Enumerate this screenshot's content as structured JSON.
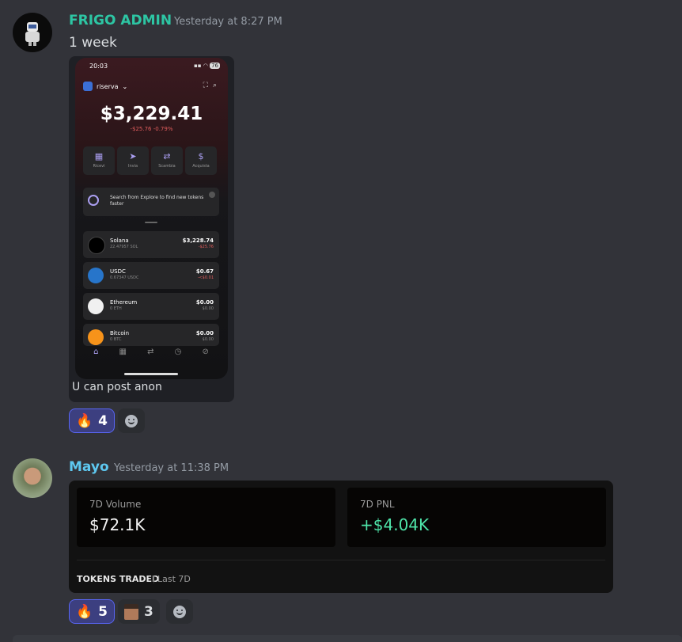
{
  "messages": [
    {
      "author": "FRIGO ADMIN",
      "author_color": "#2dc6a4",
      "timestamp": "Yesterday at 8:27 PM",
      "text": "1 week",
      "attachment": {
        "caption": "U can post anon",
        "phone": {
          "time": "20:03",
          "battery": "76",
          "account": "riserva",
          "balance": "$3,229.41",
          "change": "-$25.76 -0.79%",
          "actions": [
            "Ricevi",
            "Invia",
            "Scambia",
            "Acquista"
          ],
          "explore_text": "Search from Explore to find new tokens faster",
          "tokens": [
            {
              "name": "Solana",
              "sub": "22.47957 SOL",
              "value": "$3,228.74",
              "change": "-$25.76"
            },
            {
              "name": "USDC",
              "sub": "0.67347 USDC",
              "value": "$0.67",
              "change": "-<$0.01"
            },
            {
              "name": "Ethereum",
              "sub": "0 ETH",
              "value": "$0.00",
              "change": "$0.00"
            },
            {
              "name": "Bitcoin",
              "sub": "0 BTC",
              "value": "$0.00",
              "change": "$0.00"
            }
          ]
        }
      },
      "reactions": [
        {
          "emoji": "🔥",
          "count": "4"
        }
      ]
    },
    {
      "author": "Mayo",
      "author_color": "#5ec8f0",
      "timestamp": "Yesterday at 11:38 PM",
      "embed": {
        "stats": [
          {
            "label": "7D Volume",
            "value": "$72.1K"
          },
          {
            "label": "7D PNL",
            "value": "+$4.04K"
          }
        ],
        "section_title": "TOKENS TRADED",
        "section_sub": "Last 7D"
      },
      "reactions": [
        {
          "emoji": "🔥",
          "count": "5"
        },
        {
          "emoji": "avatar",
          "count": "3"
        }
      ]
    }
  ]
}
